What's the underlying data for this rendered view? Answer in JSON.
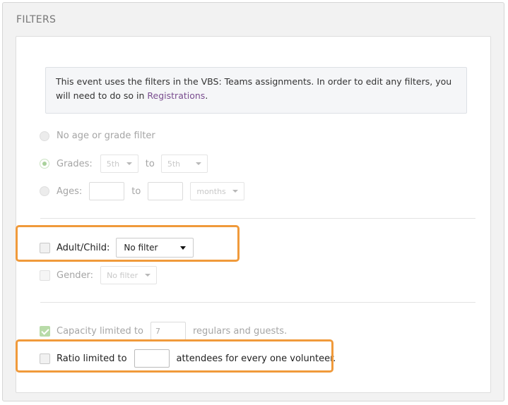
{
  "panel_title": "FILTERS",
  "notice": {
    "text": "This event uses the filters in the VBS: Teams assignments. In order to edit any filters, you will need to do so in ",
    "link": "Registrations",
    "end": "."
  },
  "age_filter": {
    "none_label": "No age or grade filter",
    "grades_label": "Grades:",
    "grades_from": "5th",
    "grades_to_word": "to",
    "grades_to": "5th",
    "ages_label": "Ages:",
    "ages_to_word": "to",
    "ages_unit": "months",
    "selected": "grades"
  },
  "adult_child": {
    "label": "Adult/Child:",
    "value": "No filter"
  },
  "gender": {
    "label": "Gender:",
    "value": "No filter"
  },
  "capacity": {
    "label": "Capacity limited to",
    "value": "7",
    "suffix": "regulars and guests.",
    "checked": true
  },
  "ratio": {
    "label": "Ratio limited to",
    "value": "",
    "suffix": "attendees for every one volunteer."
  },
  "colors": {
    "highlight": "#f09a3b",
    "link": "#7a4d8f",
    "check_green": "#b8dba8"
  }
}
